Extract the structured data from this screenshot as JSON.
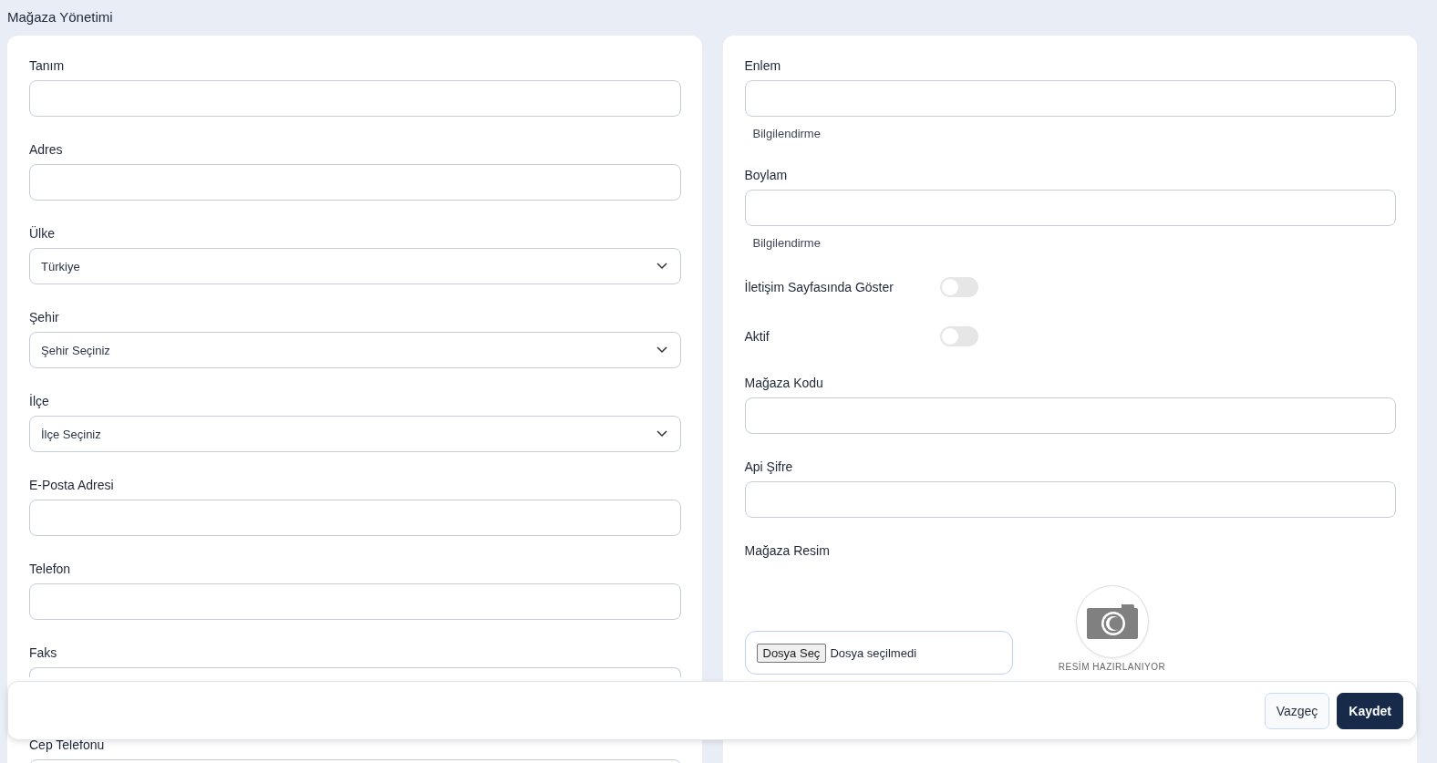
{
  "page_title": "Mağaza Yönetimi",
  "left_fields": [
    {
      "kind": "text",
      "label": "Tanım"
    },
    {
      "kind": "text",
      "label": "Adres"
    },
    {
      "kind": "select",
      "label": "Ülke",
      "value": "Türkiye"
    },
    {
      "kind": "select",
      "label": "Şehir",
      "value": "Şehir Seçiniz"
    },
    {
      "kind": "select",
      "label": "İlçe",
      "value": "İlçe Seçiniz"
    },
    {
      "kind": "text",
      "label": "E-Posta Adresi"
    },
    {
      "kind": "text",
      "label": "Telefon"
    },
    {
      "kind": "text",
      "label": "Faks"
    },
    {
      "kind": "text",
      "label": "Cep Telefonu"
    }
  ],
  "right_fields": [
    {
      "kind": "text",
      "label": "Enlem",
      "hint": "Bilgilendirme"
    },
    {
      "kind": "text",
      "label": "Boylam",
      "hint": "Bilgilendirme"
    },
    {
      "kind": "toggle",
      "label": "İletişim Sayfasında Göster",
      "on": false
    },
    {
      "kind": "toggle",
      "label": "Aktif",
      "on": false
    },
    {
      "kind": "text",
      "label": "Mağaza Kodu"
    },
    {
      "kind": "text",
      "label": "Api Şifre"
    },
    {
      "kind": "image",
      "label": "Mağaza Resim",
      "file_button": "Dosya Seç",
      "file_status": "Dosya seçilmedi",
      "preview_caption": "RESİM HAZIRLANIYOR"
    }
  ],
  "footer": {
    "buttons": [
      {
        "label": "Vazgeç",
        "kind": "secondary"
      },
      {
        "label": "Kaydet",
        "kind": "primary"
      }
    ]
  }
}
